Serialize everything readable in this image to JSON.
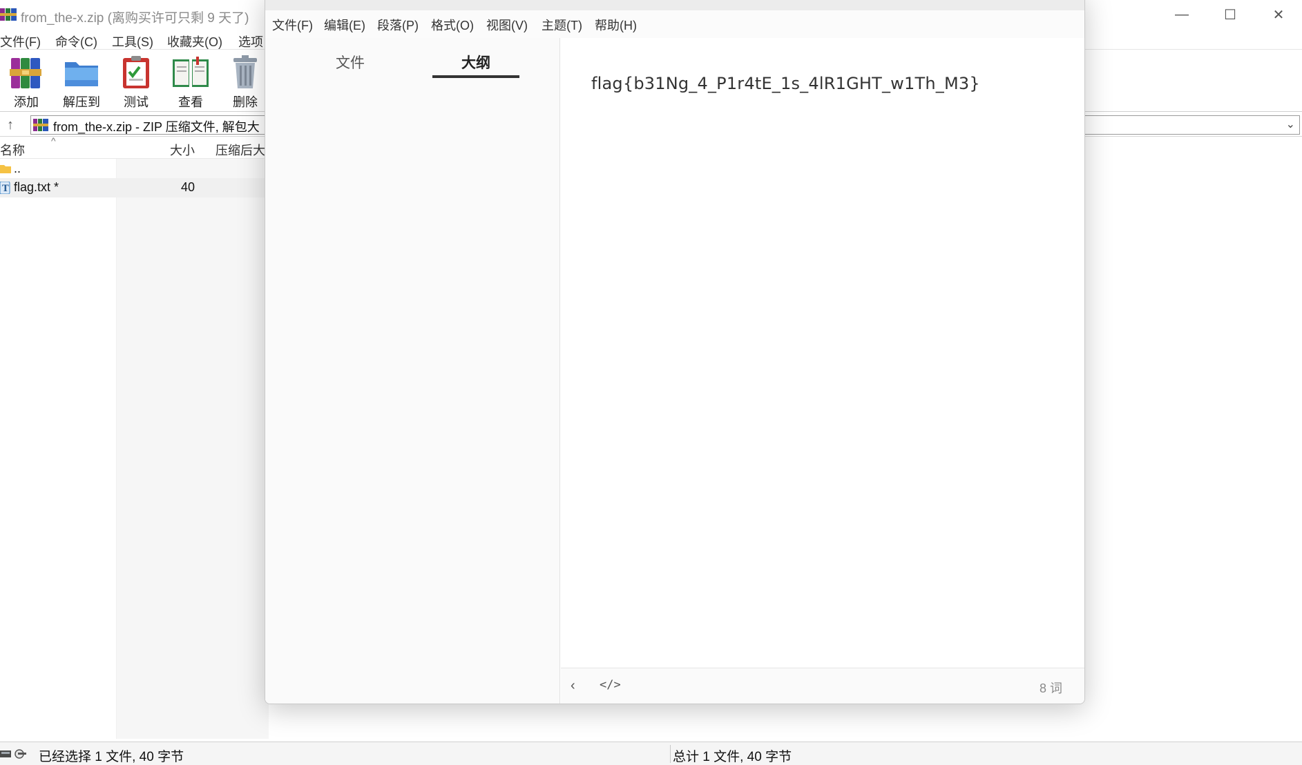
{
  "winrar": {
    "title": "from_the-x.zip (离购买许可只剩 9 天了)",
    "menu": [
      "文件(F)",
      "命令(C)",
      "工具(S)",
      "收藏夹(O)",
      "选项"
    ],
    "toolbar": [
      "添加",
      "解压到",
      "测试",
      "查看",
      "删除"
    ],
    "address": "from_the-x.zip - ZIP 压缩文件, 解包大",
    "columns": {
      "name": "名称",
      "size": "大小",
      "packed": "压缩后大"
    },
    "rows": [
      {
        "name": "..",
        "size": ""
      },
      {
        "name": "flag.txt *",
        "size": "40"
      }
    ],
    "status_left": "已经选择 1 文件, 40 字节",
    "status_right": "总计 1 文件, 40 字节"
  },
  "typora": {
    "menu": [
      "文件(F)",
      "编辑(E)",
      "段落(P)",
      "格式(O)",
      "视图(V)",
      "主题(T)",
      "帮助(H)"
    ],
    "sidebar_tabs": [
      "文件",
      "大纲"
    ],
    "content": "flag{b31Ng_4_P1r4tE_1s_4lR1GHT_w1Th_M3}",
    "word_count": "8 词"
  },
  "icons": {
    "window_minimize": "minimize-icon",
    "window_maximize": "maximize-icon",
    "window_close": "close-icon"
  },
  "colors": {
    "accent": "#333333",
    "folder": "#f5c244",
    "text_file": "#3b82c4"
  }
}
